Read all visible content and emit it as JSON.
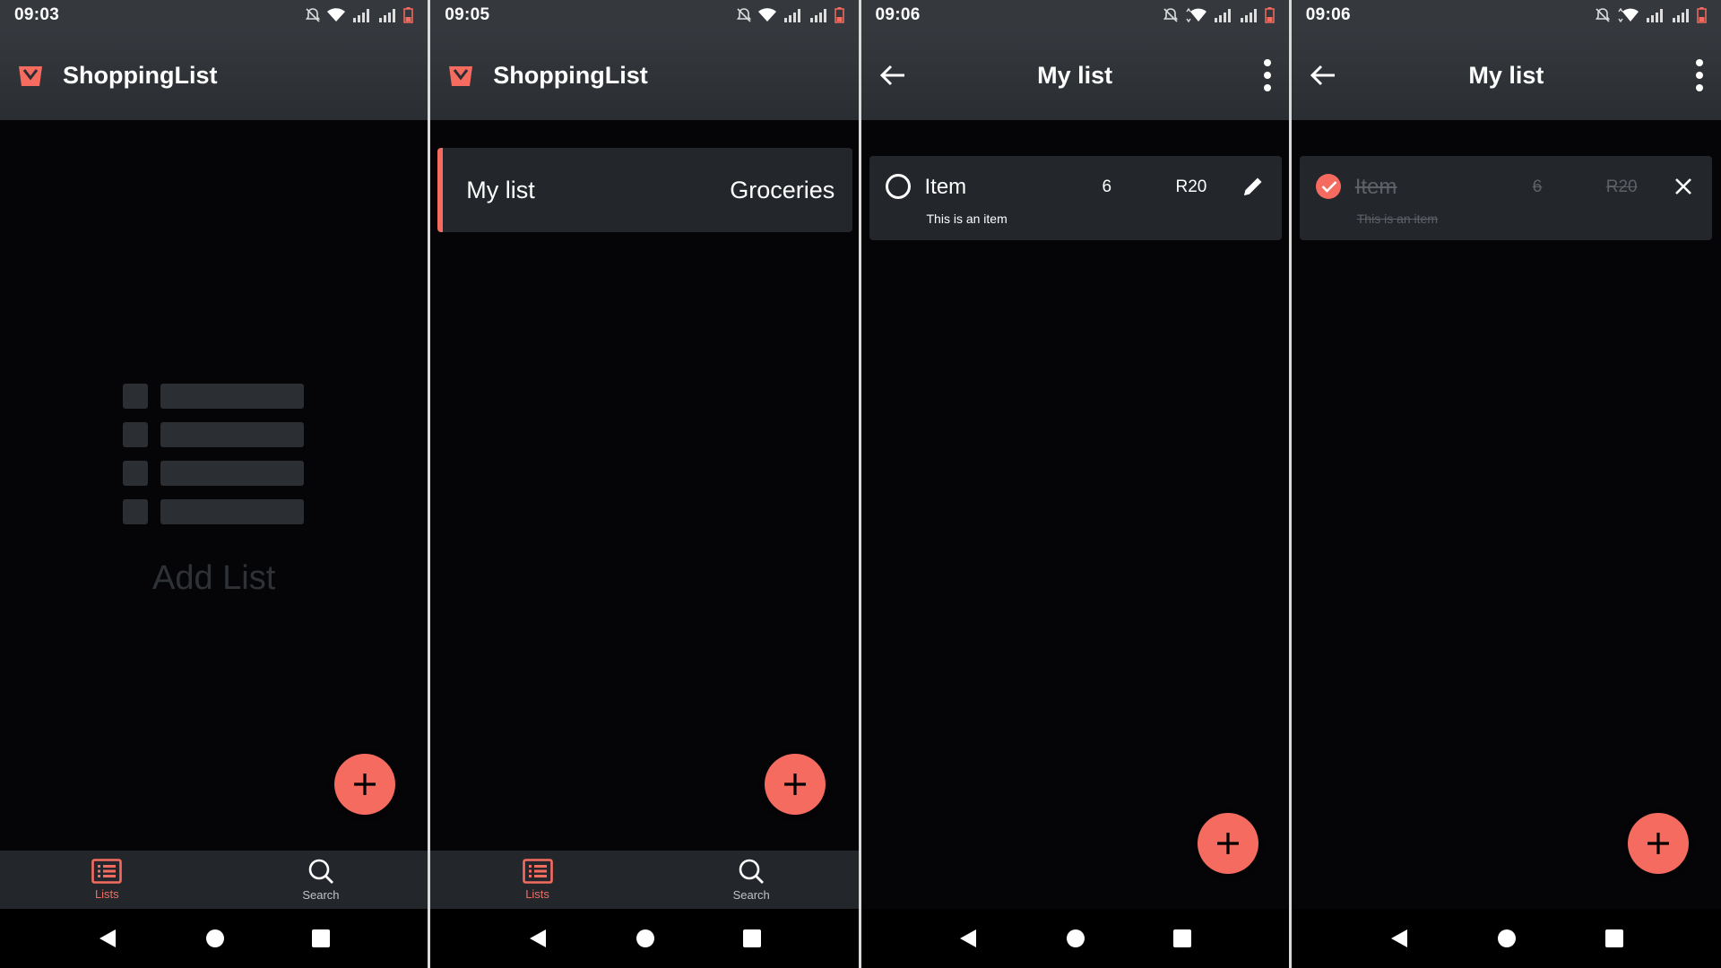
{
  "colors": {
    "accent": "#f66b60",
    "appbar": "#35393e",
    "card": "#23272c",
    "background": "#050507"
  },
  "screens": [
    {
      "time": "09:03",
      "app_title": "ShoppingList",
      "empty_text": "Add List",
      "nav": [
        {
          "label": "Lists",
          "icon": "list-icon",
          "active": true
        },
        {
          "label": "Search",
          "icon": "search-icon",
          "active": false
        }
      ]
    },
    {
      "time": "09:05",
      "app_title": "ShoppingList",
      "list": {
        "name": "My list",
        "category": "Groceries"
      },
      "nav": [
        {
          "label": "Lists",
          "icon": "list-icon",
          "active": true
        },
        {
          "label": "Search",
          "icon": "search-icon",
          "active": false
        }
      ]
    },
    {
      "time": "09:06",
      "page_title": "My list",
      "item": {
        "name": "Item",
        "quantity": "6",
        "price": "R20",
        "description": "This is an item",
        "checked": false,
        "action_icon": "pencil-icon"
      }
    },
    {
      "time": "09:06",
      "page_title": "My list",
      "item": {
        "name": "Item",
        "quantity": "6",
        "price": "R20",
        "description": "This is an item",
        "checked": true,
        "action_icon": "close-icon"
      }
    }
  ]
}
